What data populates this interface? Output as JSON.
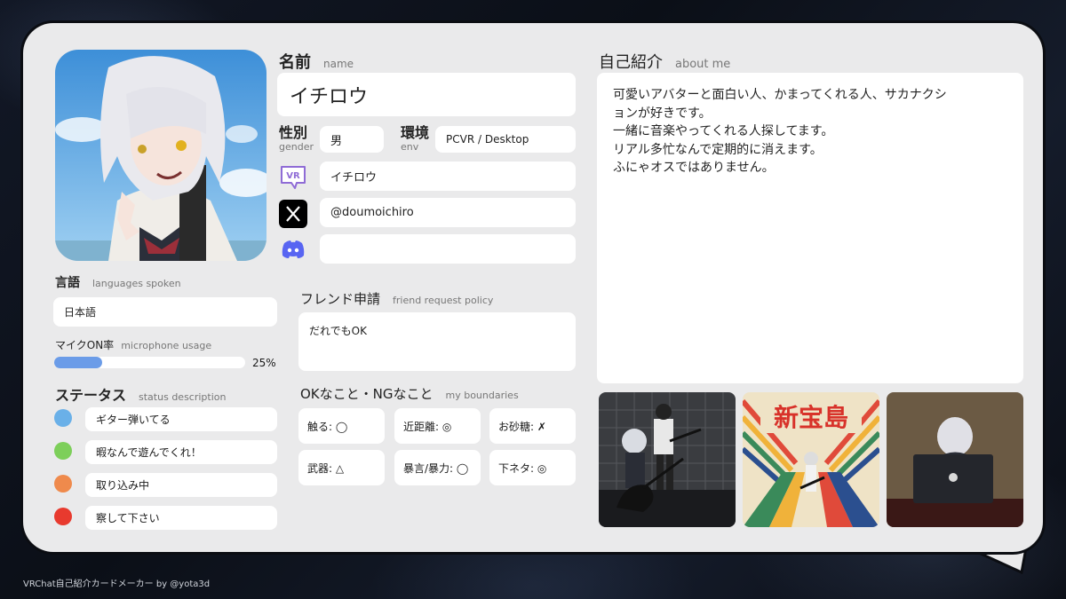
{
  "name_section": {
    "label_jp": "名前",
    "label_en": "name",
    "value": "イチロウ"
  },
  "gender": {
    "label_jp": "性別",
    "label_en": "gender",
    "value": "男"
  },
  "env": {
    "label_jp": "環境",
    "label_en": "env",
    "value": "PCVR / Desktop"
  },
  "accounts": {
    "vrchat": {
      "icon": "vrchat-icon",
      "value": "イチロウ"
    },
    "x": {
      "icon": "x-icon",
      "value": "@doumoichiro"
    },
    "discord": {
      "icon": "discord-icon",
      "value": ""
    }
  },
  "languages": {
    "label_jp": "言語",
    "label_en": "languages spoken",
    "value": "日本語"
  },
  "mic": {
    "label_jp": "マイクON率",
    "label_en": "microphone usage",
    "percent": 25,
    "percent_text": "25%"
  },
  "status": {
    "label_jp": "ステータス",
    "label_en": "status description",
    "items": [
      {
        "color": "#6ab0e8",
        "text": "ギター弾いてる"
      },
      {
        "color": "#7dcf5a",
        "text": "暇なんで遊んでくれ！"
      },
      {
        "color": "#ef8a4c",
        "text": "取り込み中"
      },
      {
        "color": "#e83a2e",
        "text": "察して下さい"
      }
    ]
  },
  "friend": {
    "label_jp": "フレンド申請",
    "label_en": "friend request policy",
    "value": "だれでもOK"
  },
  "boundaries": {
    "label_jp": "OKなこと・NGなこと",
    "label_en": "my boundaries",
    "items": [
      "触る: ◯",
      "近距離: ◎",
      "お砂糖: ✗",
      "武器: △",
      "暴言/暴力: ◯",
      "下ネタ: ◎"
    ]
  },
  "about": {
    "label_jp": "自己紹介",
    "label_en": "about me",
    "lines": [
      "可愛いアバターと面白い人、かまってくれる人、サカナクシ",
      "ョンが好きです。",
      "一緒に音楽やってくれる人探してます。",
      "リアル多忙なんで定期的に消えます。",
      "ふにゃオスではありません。"
    ]
  },
  "gallery": {
    "thumb2_text": "新宝島"
  },
  "footer": "VRChat自己紹介カードメーカー by @yota3d"
}
